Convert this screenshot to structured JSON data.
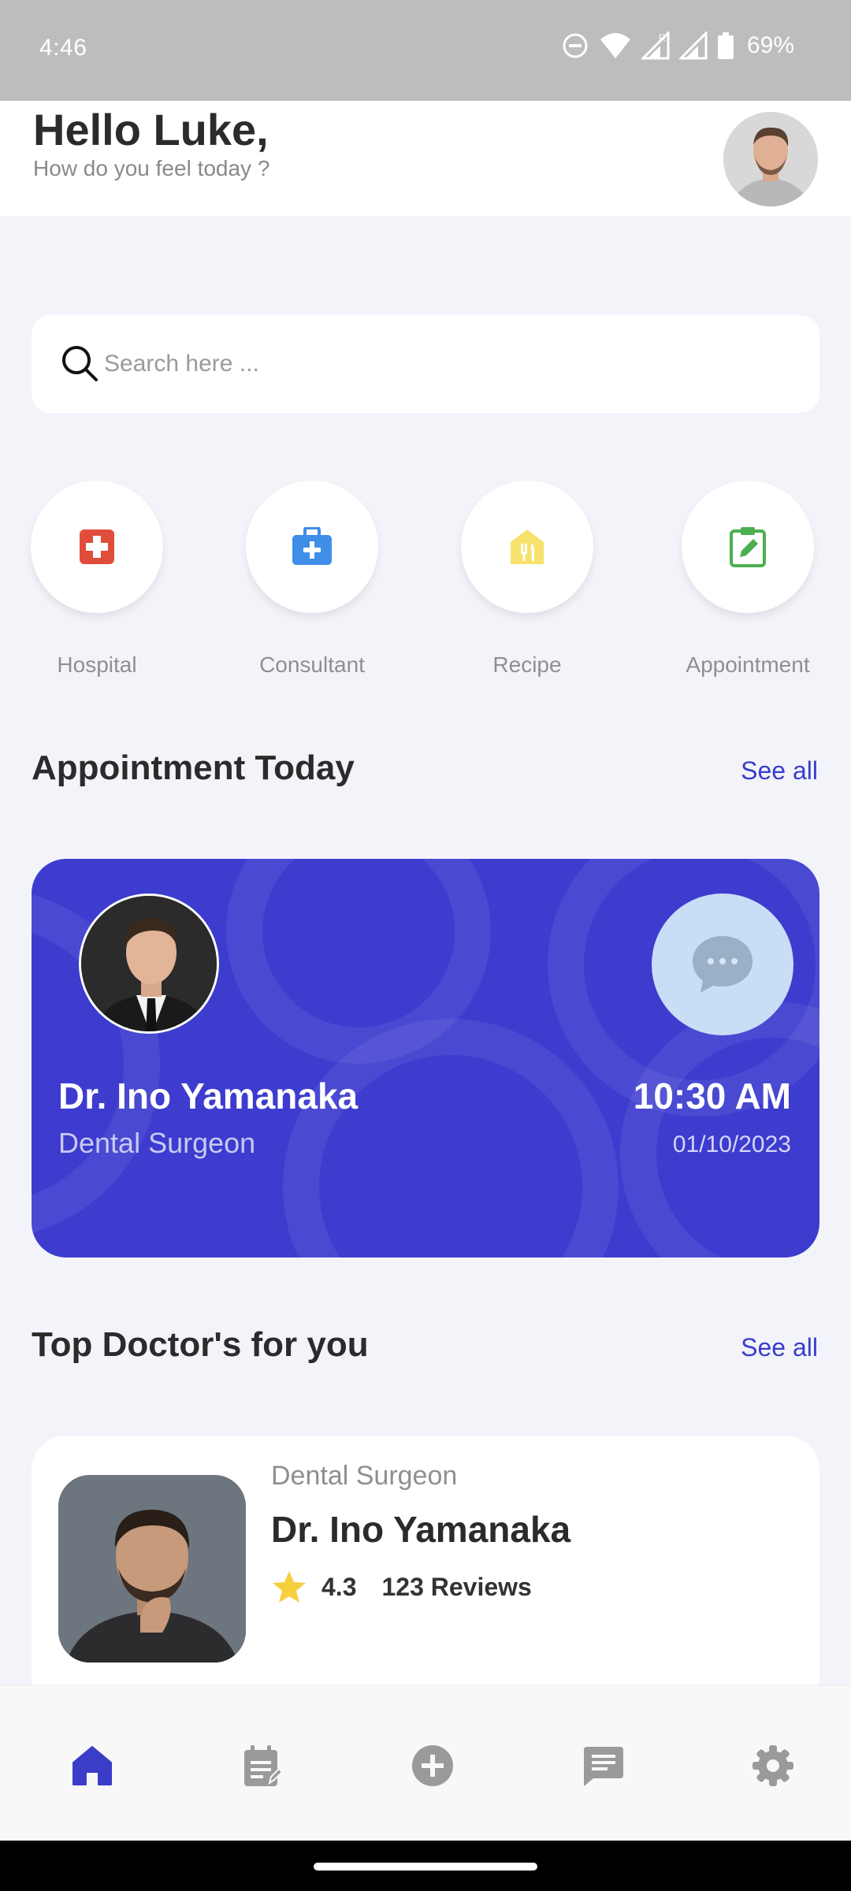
{
  "status_bar": {
    "time": "4:46",
    "battery": "69%",
    "icons": [
      "do-not-disturb-icon",
      "wifi-icon",
      "signal-icon",
      "signal-roaming-icon",
      "battery-icon"
    ]
  },
  "header": {
    "greeting": "Hello Luke,",
    "subtitle": "How do you feel today ?"
  },
  "search": {
    "placeholder": "Search here ..."
  },
  "categories": [
    {
      "label": "Hospital",
      "icon": "hospital-icon",
      "color": "#e24d3b"
    },
    {
      "label": "Consultant",
      "icon": "medical-bag-icon",
      "color": "#3f8ee8"
    },
    {
      "label": "Recipe",
      "icon": "food-tag-icon",
      "color": "#f7e26b"
    },
    {
      "label": "Appointment",
      "icon": "clipboard-edit-icon",
      "color": "#4caf50"
    }
  ],
  "appointment_section": {
    "title": "Appointment Today",
    "see_all": "See all",
    "card": {
      "doctor_name": "Dr. Ino Yamanaka",
      "specialty": "Dental Surgeon",
      "time": "10:30 AM",
      "date": "01/10/2023",
      "background": "#3d3ccf"
    }
  },
  "top_doctors_section": {
    "title": "Top Doctor's for you",
    "see_all": "See all",
    "doctors": [
      {
        "specialty": "Dental Surgeon",
        "name": "Dr. Ino Yamanaka",
        "rating": "4.3",
        "reviews": "123 Reviews"
      }
    ]
  },
  "bottom_nav": {
    "items": [
      {
        "icon": "home-icon",
        "active": true
      },
      {
        "icon": "notes-icon",
        "active": false
      },
      {
        "icon": "add-circle-icon",
        "active": false
      },
      {
        "icon": "chat-icon",
        "active": false
      },
      {
        "icon": "settings-icon",
        "active": false
      }
    ],
    "active_color": "#3a3dc8",
    "inactive_color": "#9a9a9a"
  }
}
